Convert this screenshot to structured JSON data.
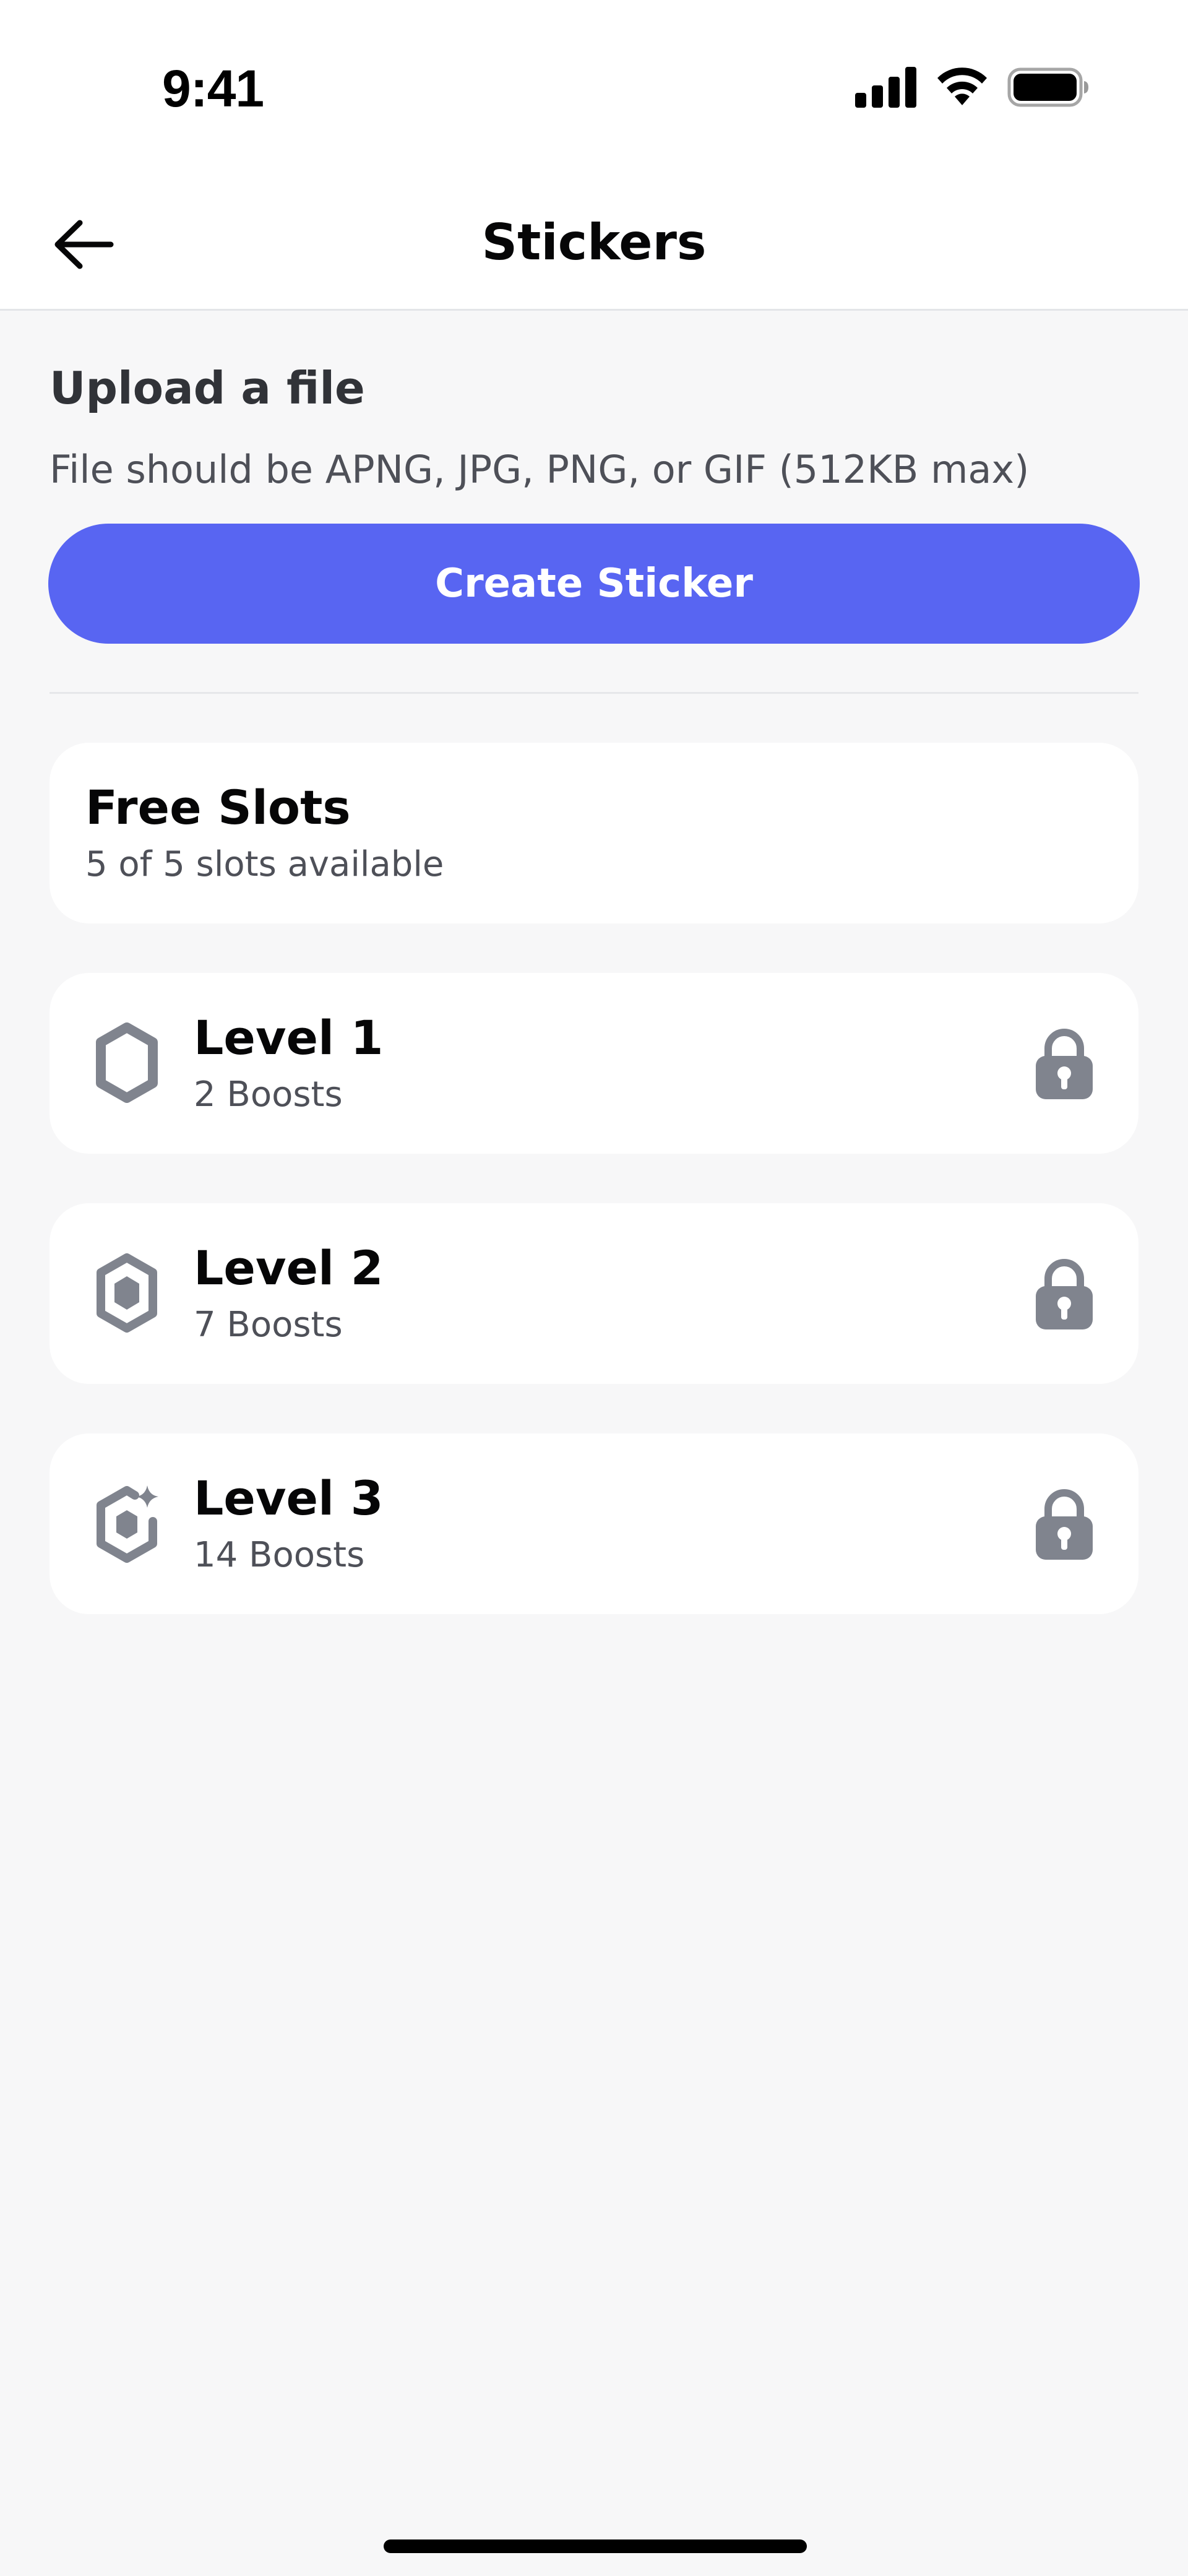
{
  "status_bar": {
    "time": "9:41"
  },
  "header": {
    "title": "Stickers"
  },
  "upload": {
    "title": "Upload a file",
    "description": "File should be APNG, JPG, PNG, or GIF (512KB max)",
    "button_label": "Create Sticker"
  },
  "free_slots": {
    "title": "Free Slots",
    "subtitle": "5 of 5 slots available"
  },
  "levels": [
    {
      "title": "Level 1",
      "subtitle": "2 Boosts",
      "icon": "boost-level-1-icon",
      "locked": true
    },
    {
      "title": "Level 2",
      "subtitle": "7 Boosts",
      "icon": "boost-level-2-icon",
      "locked": true
    },
    {
      "title": "Level 3",
      "subtitle": "14 Boosts",
      "icon": "boost-level-3-icon",
      "locked": true
    }
  ],
  "colors": {
    "accent": "#5865f2",
    "background": "#f7f7f8",
    "card": "#ffffff",
    "icon_gray": "#80848e"
  }
}
